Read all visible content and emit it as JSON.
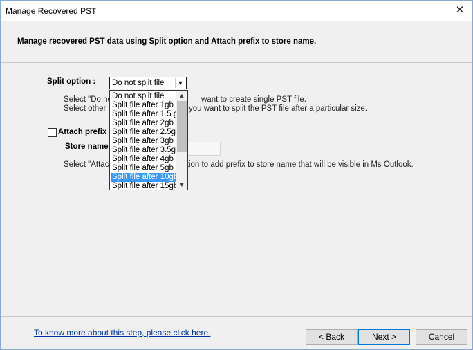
{
  "window": {
    "title": "Manage Recovered PST",
    "close_glyph": "✕"
  },
  "header": {
    "text": "Manage recovered PST data using Split option and Attach prefix to store name."
  },
  "split": {
    "label": "Split option :",
    "selected_value": "Do not split file",
    "note_line1_a": "Select \"Do no",
    "note_line1_b": "want to create single PST file.",
    "note_line2_a": "Select other P",
    "note_line2_b": "you want to split the PST file after a particular size.",
    "options": [
      "Do not split file",
      "Split file after 1gb",
      "Split file after 1.5 gb",
      "Split file after 2gb",
      "Split file after 2.5gb",
      "Split file after 3gb",
      "Split file after 3.5gb",
      "Split file after 4gb",
      "Split file after 5gb",
      "Split file after 10gb",
      "Split file after 15gb"
    ],
    "highlighted_option": "Split file after 10gb"
  },
  "attach": {
    "checkbox_label": "Attach prefix t",
    "checked": false,
    "store_label": "Store name",
    "store_value": "",
    "note_a": "Select \"Attach",
    "note_b": "option to add prefix to store name that will be visible in Ms Outlook."
  },
  "footer": {
    "help_link": "To know more about this step, please click here.",
    "back_button": "< Back",
    "next_button": "Next >",
    "cancel_button": "Cancel"
  },
  "icons": {
    "scroll_up": "chevron-up-icon",
    "scroll_down": "chevron-down-icon",
    "dropdown": "chevron-down-icon",
    "close": "close-icon"
  },
  "colors": {
    "selection": "#3399ff",
    "link": "#0033aa",
    "window_border": "#8aa8d6"
  }
}
